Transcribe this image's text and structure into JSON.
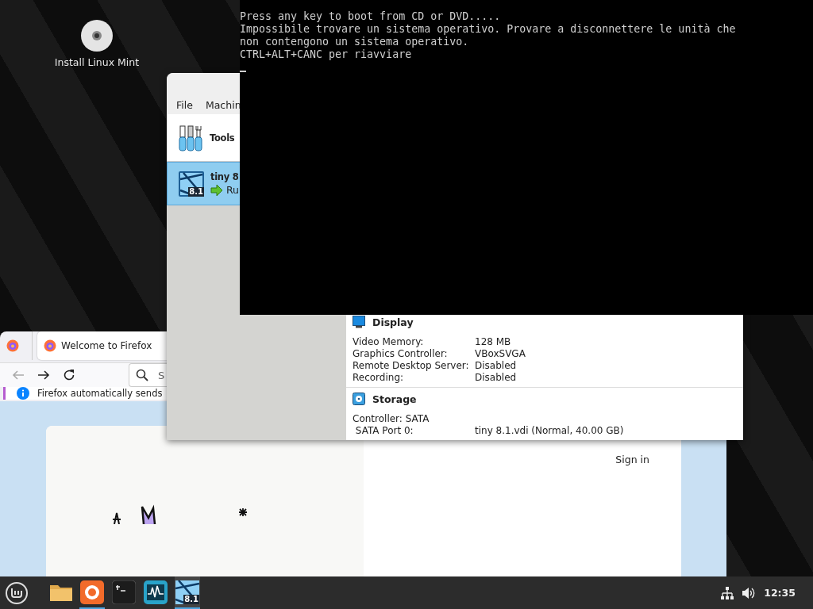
{
  "desktop": {
    "icons": [
      {
        "kind": "disc",
        "label": "Install Linux Mint"
      }
    ]
  },
  "virtualbox_window": {
    "menu": [
      "File",
      "Machin"
    ],
    "machines": [
      {
        "kind": "tools",
        "name": "Tools",
        "selected": false
      },
      {
        "kind": "vm",
        "name": "tiny 8",
        "state": "Ru",
        "icon_badge": "8.1",
        "selected": true
      }
    ],
    "details": [
      {
        "kind": "display",
        "title": "Display",
        "rows": [
          {
            "label": "Video Memory:",
            "value": "128 MB"
          },
          {
            "label": "Graphics Controller:",
            "value": "VBoxSVGA"
          },
          {
            "label": "Remote Desktop Server:",
            "value": "Disabled"
          },
          {
            "label": "Recording:",
            "value": "Disabled"
          }
        ]
      },
      {
        "kind": "storage",
        "title": "Storage",
        "rows": [
          {
            "label": "Controller: SATA"
          },
          {
            "label": " SATA Port 0:",
            "value": "tiny 8.1.vdi (Normal, 40.00 GB)"
          }
        ]
      }
    ]
  },
  "console_window": {
    "lines": [
      "Press any key to boot from CD or DVD.....",
      "Impossibile trovare un sistema operativo. Provare a disconnettere le unità che",
      "non contengono un sistema operativo.",
      "CTRL+ALT+CANC per riavviare"
    ],
    "cursor_visible": true
  },
  "firefox_window": {
    "tabs": [
      {
        "title": "Welcome to Firefox",
        "selected": true
      }
    ],
    "back_disabled": true,
    "search": {
      "placeholder": "S"
    },
    "notice": "Firefox automatically sends",
    "page": {
      "sign_in": "Sign in"
    }
  },
  "taskbar": {
    "apps": [
      {
        "kind": "files",
        "running": false,
        "active": false
      },
      {
        "kind": "firefox",
        "running": true,
        "active": false
      },
      {
        "kind": "terminal",
        "running": false,
        "active": false
      },
      {
        "kind": "monitor",
        "running": false,
        "active": false
      },
      {
        "kind": "virtualbox",
        "running": true,
        "active": true,
        "icon_badge": "8.1"
      }
    ],
    "clock": "12:35"
  }
}
